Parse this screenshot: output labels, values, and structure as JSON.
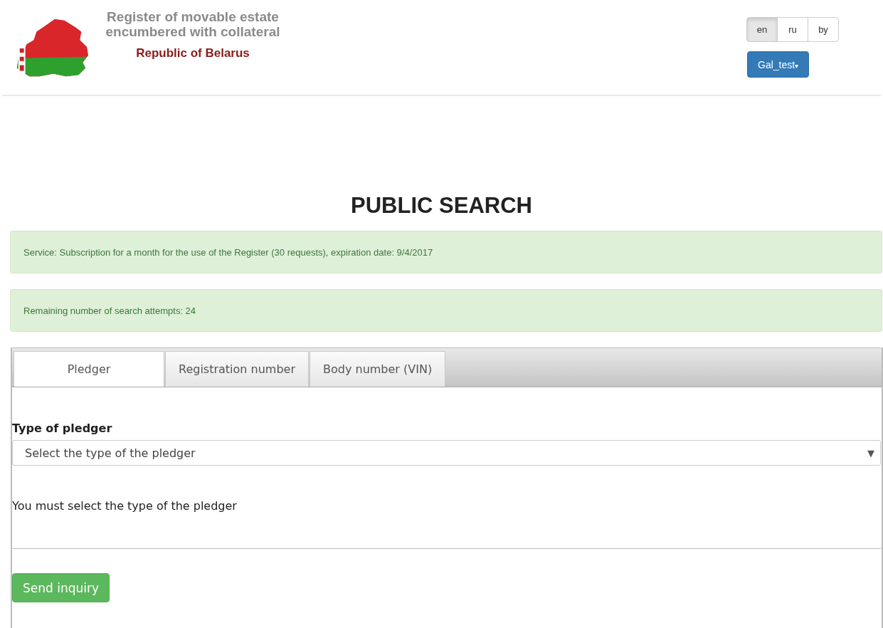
{
  "header": {
    "title": "Register of movable estate encumbered with collateral",
    "subtitle": "Republic of Belarus"
  },
  "languages": [
    {
      "label": "en",
      "selected": true
    },
    {
      "label": "ru",
      "selected": false
    },
    {
      "label": "by",
      "selected": false
    }
  ],
  "user_menu": {
    "label": "Gal_test",
    "caret": "▾"
  },
  "page_title": "PUBLIC SEARCH",
  "alerts": [
    "Service: Subscription for a month for the use of the Register (30 requests), expiration date: 9/4/2017",
    "Remaining number of search attempts: 24"
  ],
  "tabs": [
    {
      "label": "Pledger",
      "selected": true
    },
    {
      "label": "Registration number",
      "selected": false
    },
    {
      "label": "Body number (VIN)",
      "selected": false
    }
  ],
  "form": {
    "label": "Type of pledger",
    "placeholder": "Select the type of the pledger",
    "arrow": "▼",
    "message": "You must select the type of the pledger"
  },
  "submit_button": "Send inquiry"
}
